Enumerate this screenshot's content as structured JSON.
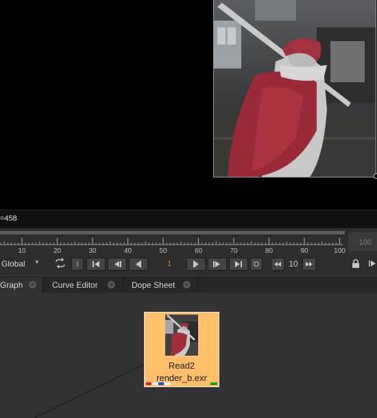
{
  "viewer": {
    "info_text": "=458"
  },
  "timeline": {
    "ticks": [
      "10",
      "20",
      "30",
      "40",
      "50",
      "60",
      "70",
      "80",
      "90",
      "100"
    ],
    "end_frame": "100"
  },
  "transport": {
    "scope": "Global",
    "current_frame": "1",
    "step_value": "10",
    "in_label": "I",
    "out_label": "O"
  },
  "tabs": [
    {
      "label": "Graph",
      "active": true
    },
    {
      "label": "Curve Editor",
      "active": false
    },
    {
      "label": "Dope Sheet",
      "active": false
    }
  ],
  "node": {
    "name": "Read2",
    "file": "render_b.exr",
    "tile_color": "#ffc069"
  },
  "colors": {
    "viewer_bg": "#000000",
    "panel_bg": "#323232",
    "frame_accent": "#e28a2a"
  }
}
